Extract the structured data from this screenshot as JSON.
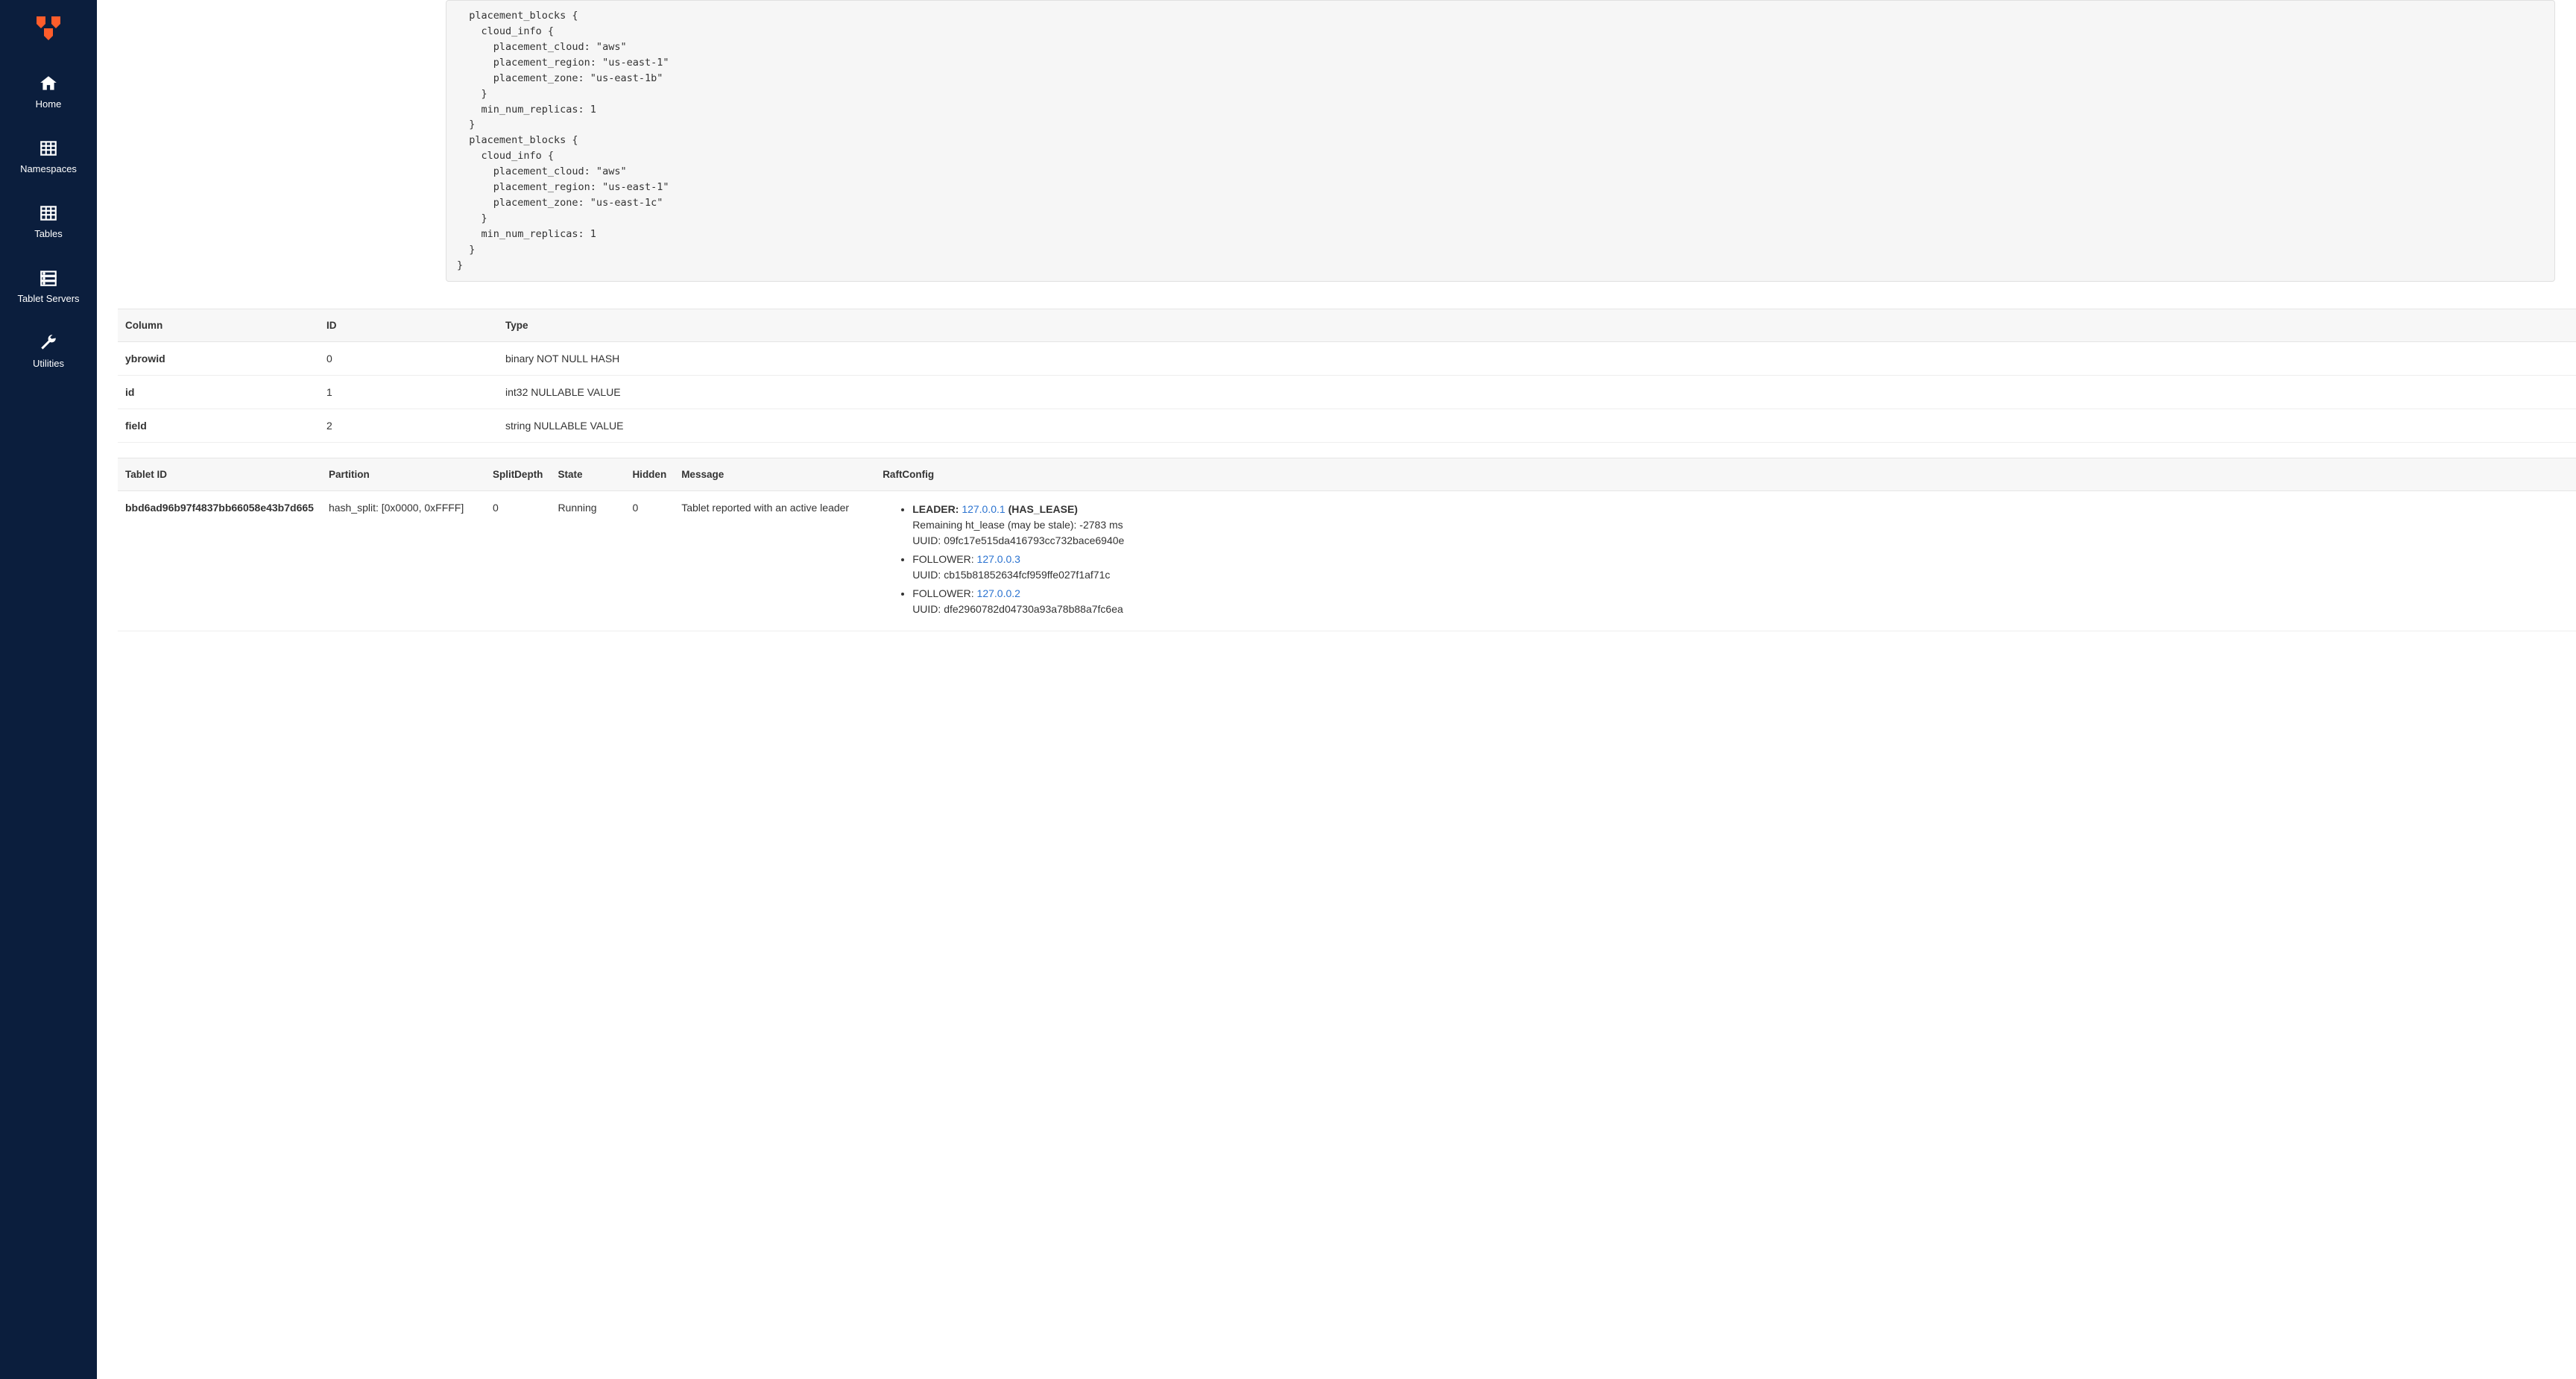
{
  "sidebar": {
    "items": [
      {
        "label": "Home"
      },
      {
        "label": "Namespaces"
      },
      {
        "label": "Tables"
      },
      {
        "label": "Tablet Servers"
      },
      {
        "label": "Utilities"
      }
    ]
  },
  "replication_config": "  placement_blocks {\n    cloud_info {\n      placement_cloud: \"aws\"\n      placement_region: \"us-east-1\"\n      placement_zone: \"us-east-1b\"\n    }\n    min_num_replicas: 1\n  }\n  placement_blocks {\n    cloud_info {\n      placement_cloud: \"aws\"\n      placement_region: \"us-east-1\"\n      placement_zone: \"us-east-1c\"\n    }\n    min_num_replicas: 1\n  }\n}",
  "columns_table": {
    "headers": {
      "column": "Column",
      "id": "ID",
      "type": "Type"
    },
    "rows": [
      {
        "name": "ybrowid",
        "id": "0",
        "type": "binary NOT NULL HASH"
      },
      {
        "name": "id",
        "id": "1",
        "type": "int32 NULLABLE VALUE"
      },
      {
        "name": "field",
        "id": "2",
        "type": "string NULLABLE VALUE"
      }
    ]
  },
  "tablets_table": {
    "headers": {
      "tablet_id": "Tablet ID",
      "partition": "Partition",
      "split_depth": "SplitDepth",
      "state": "State",
      "hidden": "Hidden",
      "message": "Message",
      "raft_config": "RaftConfig"
    },
    "rows": [
      {
        "tablet_id": "bbd6ad96b97f4837bb66058e43b7d665",
        "partition": "hash_split: [0x0000, 0xFFFF]",
        "split_depth": "0",
        "state": "Running",
        "hidden": "0",
        "message": "Tablet reported with an active leader",
        "raft": [
          {
            "role_prefix": "LEADER: ",
            "addr": "127.0.0.1",
            "suffix": " (HAS_LEASE)",
            "line2": "Remaining ht_lease (may be stale): -2783 ms",
            "uuid": "UUID: 09fc17e515da416793cc732bace6940e"
          },
          {
            "role_prefix": "FOLLOWER: ",
            "addr": "127.0.0.3",
            "suffix": "",
            "line2": "",
            "uuid": "UUID: cb15b81852634fcf959ffe027f1af71c"
          },
          {
            "role_prefix": "FOLLOWER: ",
            "addr": "127.0.0.2",
            "suffix": "",
            "line2": "",
            "uuid": "UUID: dfe2960782d04730a93a78b88a7fc6ea"
          }
        ]
      }
    ]
  }
}
